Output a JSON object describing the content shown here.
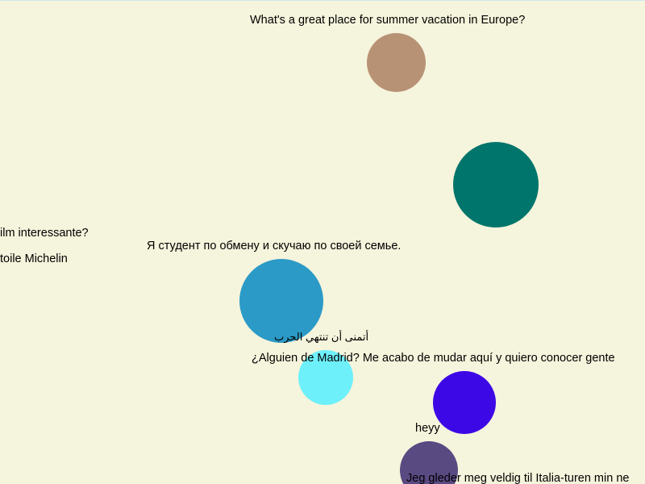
{
  "messages": {
    "m1": "What's a great place for summer vacation in Europe?",
    "m2": "ilm interessante?",
    "m3": "toile Michelin",
    "m4": "Я студент по обмену и скучаю по своей семье.",
    "m5": "أتمنى أن تنتهي الحرب",
    "m6": "¿Alguien de Madrid? Me acabo de mudar aquí y quiero conocer gente",
    "m7": "heyy",
    "m8": "Jeg gleder meg veldig til Italia-turen min ne"
  },
  "bubble_colors": {
    "b1": "#b89274",
    "b2": "#00756b",
    "b3": "#2b9ac7",
    "b4": "#6ef0fa",
    "b5": "#3d08e6",
    "b6": "#5a4a82"
  },
  "background": "#f5f4dc"
}
